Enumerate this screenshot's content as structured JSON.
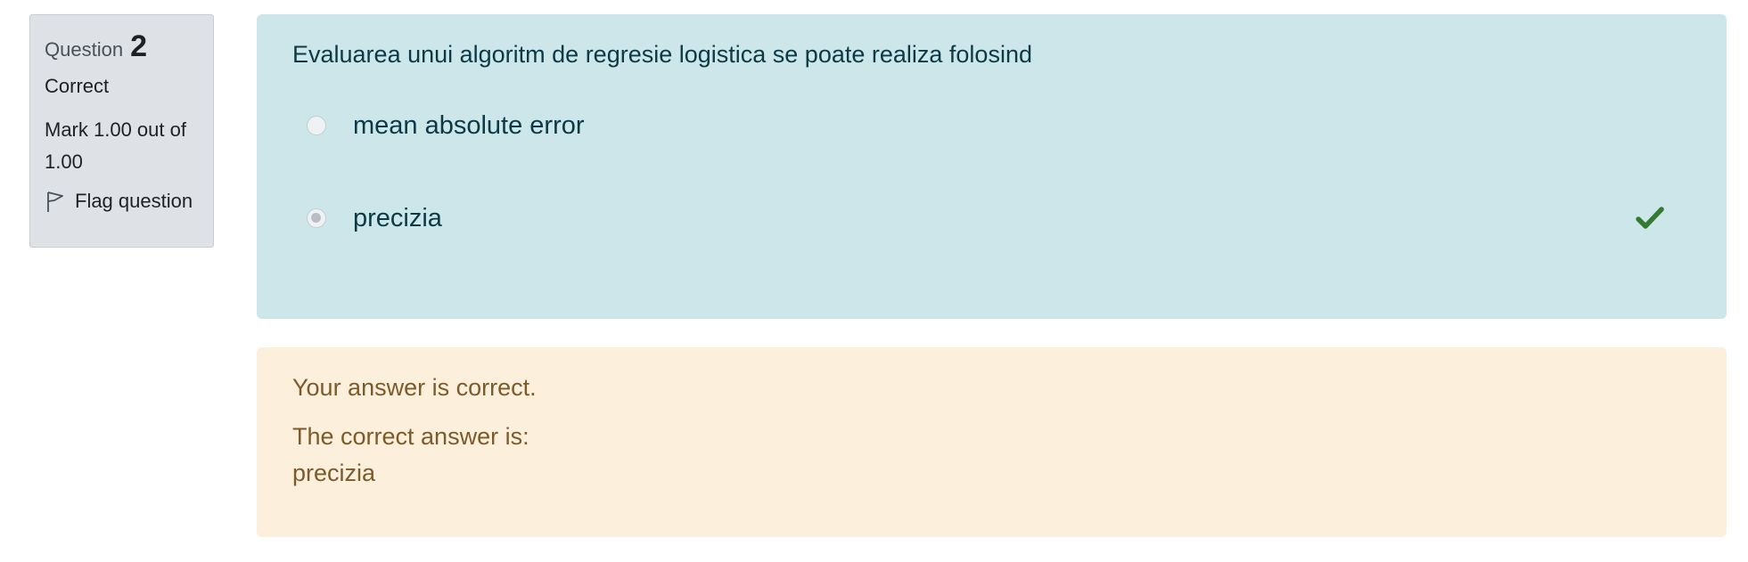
{
  "info": {
    "question_word": "Question",
    "question_number": "2",
    "state": "Correct",
    "grade": "Mark 1.00 out of 1.00",
    "flag_label": "Flag question"
  },
  "question": {
    "text": "Evaluarea unui algoritm de regresie logistica se poate realiza folosind",
    "answers": [
      {
        "label": "mean absolute error",
        "selected": false
      },
      {
        "label": "precizia",
        "selected": true,
        "correct": true
      }
    ]
  },
  "feedback": {
    "result": "Your answer is correct.",
    "correct_answer_label": "The correct answer is:",
    "correct_answer": "precizia"
  },
  "icons": {
    "flag": "flag-icon",
    "correct": "check-icon"
  },
  "colors": {
    "info_bg": "#dee2e6",
    "question_bg": "#cce6ea",
    "feedback_bg": "#fcefdc",
    "correct_check": "#357a32"
  }
}
